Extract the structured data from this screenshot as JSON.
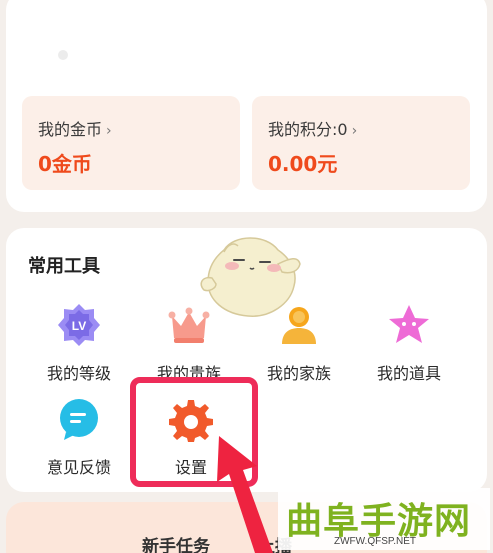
{
  "wallet": {
    "coins_label": "我的金币",
    "coins_value": "0金币",
    "points_label": "我的积分:0",
    "points_value": "0.00元",
    "chevron": "›"
  },
  "tools": {
    "title": "常用工具",
    "items": [
      {
        "label": "我的等级",
        "icon": "level-badge-icon",
        "badge_text": "LV"
      },
      {
        "label": "我的贵族",
        "icon": "crown-icon"
      },
      {
        "label": "我的家族",
        "icon": "family-icon"
      },
      {
        "label": "我的道具",
        "icon": "props-star-icon"
      },
      {
        "label": "意见反馈",
        "icon": "feedback-icon"
      },
      {
        "label": "设置",
        "icon": "gear-icon"
      }
    ]
  },
  "bottom": {
    "task_label": "新手任务",
    "partial_label": "上播"
  },
  "watermark": {
    "title": "曲阜手游网",
    "url": "ZWFW.QFSP.NET"
  },
  "colors": {
    "accent": "#ef4a1c",
    "highlight": "#ee2c59",
    "watermark": "#7fb21f"
  }
}
